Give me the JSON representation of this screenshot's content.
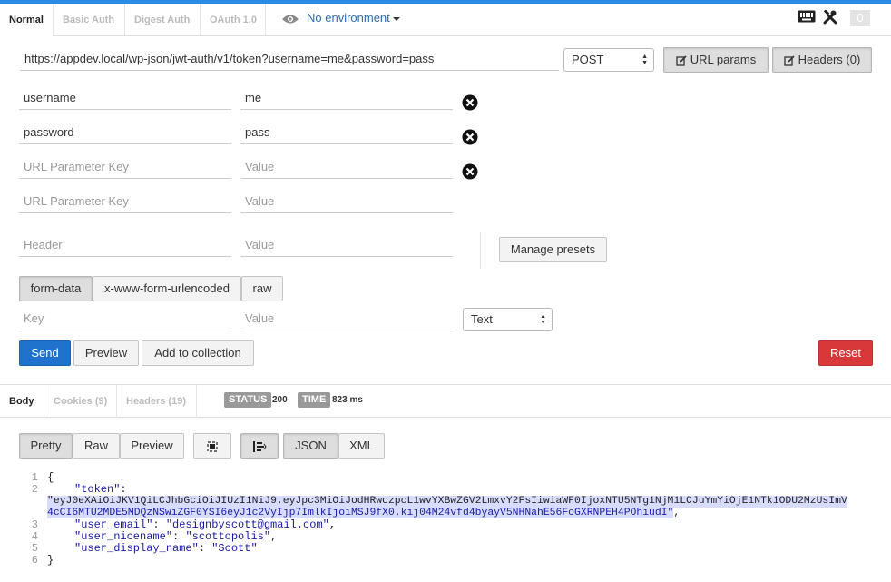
{
  "auth_tabs": [
    "Normal",
    "Basic Auth",
    "Digest Auth",
    "OAuth 1.0"
  ],
  "environment": "No environment",
  "history_count": "0",
  "request": {
    "url": "https://appdev.local/wp-json/jwt-auth/v1/token?username=me&password=pass",
    "method": "POST",
    "url_params_label": "URL params",
    "headers_label": "Headers (0)"
  },
  "params": [
    {
      "key": "username",
      "value": "me"
    },
    {
      "key": "password",
      "value": "pass"
    }
  ],
  "placeholders": {
    "param_key": "URL Parameter Key",
    "param_value": "Value",
    "header": "Header",
    "header_value": "Value",
    "body_key": "Key",
    "body_value": "Value"
  },
  "manage_presets_label": "Manage presets",
  "body_types": [
    "form-data",
    "x-www-form-urlencoded",
    "raw"
  ],
  "body_value_type": "Text",
  "actions": {
    "send": "Send",
    "preview": "Preview",
    "add_to_collection": "Add to collection",
    "reset": "Reset"
  },
  "response_tabs": [
    "Body",
    "Cookies (9)",
    "Headers (19)"
  ],
  "status": {
    "label": "STATUS",
    "value": "200"
  },
  "time": {
    "label": "TIME",
    "value": "823 ms"
  },
  "view_modes": [
    "Pretty",
    "Raw",
    "Preview"
  ],
  "formats": [
    "JSON",
    "XML"
  ],
  "response_lines": {
    "l1": "{",
    "token_key": "\"token\"",
    "token_part1": "\"eyJ0eXAiOiJKV1QiLCJhbGciOiJIUzI1NiJ9.eyJpc3MiOiJodHRwczpcL1wvYXBwZGV2LmxvY2FsIiwiaWF0IjoxNTU5NTg1NjM1LCJuYmYiOjE1NTk1ODU2MzUsImV",
    "token_part2": "4cCI6MTU2MDE5MDQzNSwiZGF0YSI6eyJ1c2VyIjp7ImlkIjoiMSJ9fX0.kij04M24vfd4byayV5NHNahE56FoGXRNPEH4POhiudI\"",
    "email_key": "\"user_email\"",
    "email_val": "\"designbyscott@gmail.com\"",
    "nicename_key": "\"user_nicename\"",
    "nicename_val": "\"scottopolis\"",
    "display_key": "\"user_display_name\"",
    "display_val": "\"Scott\"",
    "l6": "}"
  },
  "line_numbers": [
    "1",
    "2",
    "3",
    "4",
    "5",
    "6"
  ]
}
